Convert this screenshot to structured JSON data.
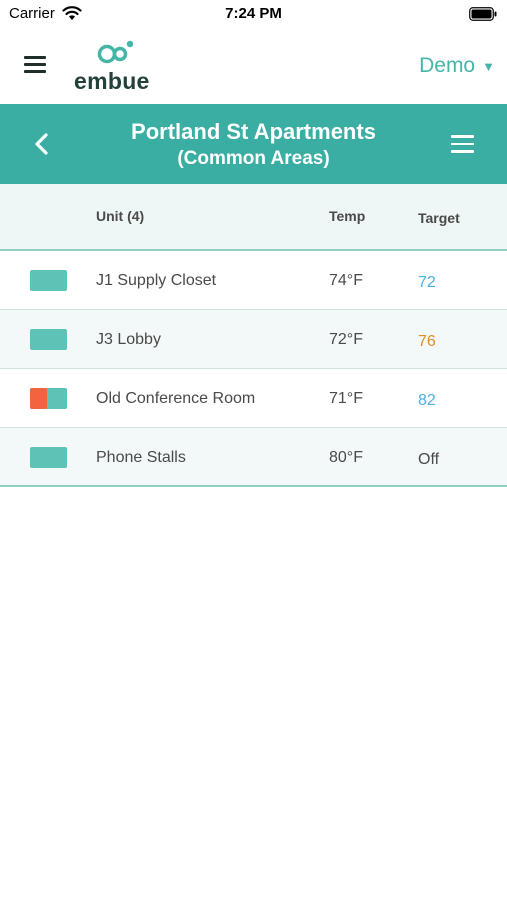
{
  "status_bar": {
    "carrier": "Carrier",
    "time": "7:24 PM",
    "wifi_icon": "wifi-icon",
    "battery_icon": "battery-icon"
  },
  "app_bar": {
    "menu_icon": "hamburger-menu-icon",
    "logo_text": "embue",
    "account": "Demo",
    "account_caret": "▼"
  },
  "header": {
    "back_icon": "chevron-left-icon",
    "title": "Portland St Apartments",
    "subtitle": "(Common Areas)",
    "menu_icon": "hamburger-menu-icon"
  },
  "table": {
    "columns": {
      "unit": "Unit (4)",
      "temp": "Temp",
      "target": "Target"
    },
    "rows": [
      {
        "name": "J1 Supply Closet",
        "temp": "74°F",
        "target": "72",
        "target_color": "#4ab0e0",
        "status": "normal"
      },
      {
        "name": "J3 Lobby",
        "temp": "72°F",
        "target": "76",
        "target_color": "#e08a2c",
        "status": "normal"
      },
      {
        "name": "Old Conference Room",
        "temp": "71°F",
        "target": "82",
        "target_color": "#4ab0e0",
        "status": "heating"
      },
      {
        "name": "Phone Stalls",
        "temp": "80°F",
        "target": "Off",
        "target_color": "#4a4a4a",
        "status": "normal"
      }
    ]
  },
  "colors": {
    "brand_teal": "#3aaea3",
    "swatch_teal": "#5dc3b7",
    "heating_red": "#f2633f",
    "setpoint_blue": "#4ab0e0",
    "setpoint_orange": "#e08a2c"
  }
}
